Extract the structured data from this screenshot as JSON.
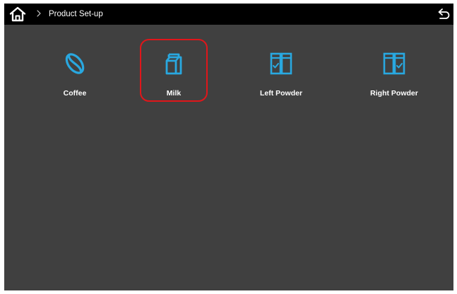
{
  "header": {
    "home_icon": "home-icon",
    "separator_icon": "chevron-right-icon",
    "breadcrumb": "Product Set-up",
    "back_icon": "back-arrow-icon"
  },
  "products": [
    {
      "label": "Coffee",
      "icon": "coffee-bean-icon"
    },
    {
      "label": "Milk",
      "icon": "milk-carton-icon",
      "selected": true
    },
    {
      "label": "Left Powder",
      "icon": "left-powder-container-icon"
    },
    {
      "label": "Right Powder",
      "icon": "right-powder-container-icon"
    }
  ],
  "colors": {
    "background": "#404040",
    "header": "#000000",
    "icon_accent": "#29a8e0",
    "selection_outline": "#e0161a",
    "text": "#ffffff"
  }
}
